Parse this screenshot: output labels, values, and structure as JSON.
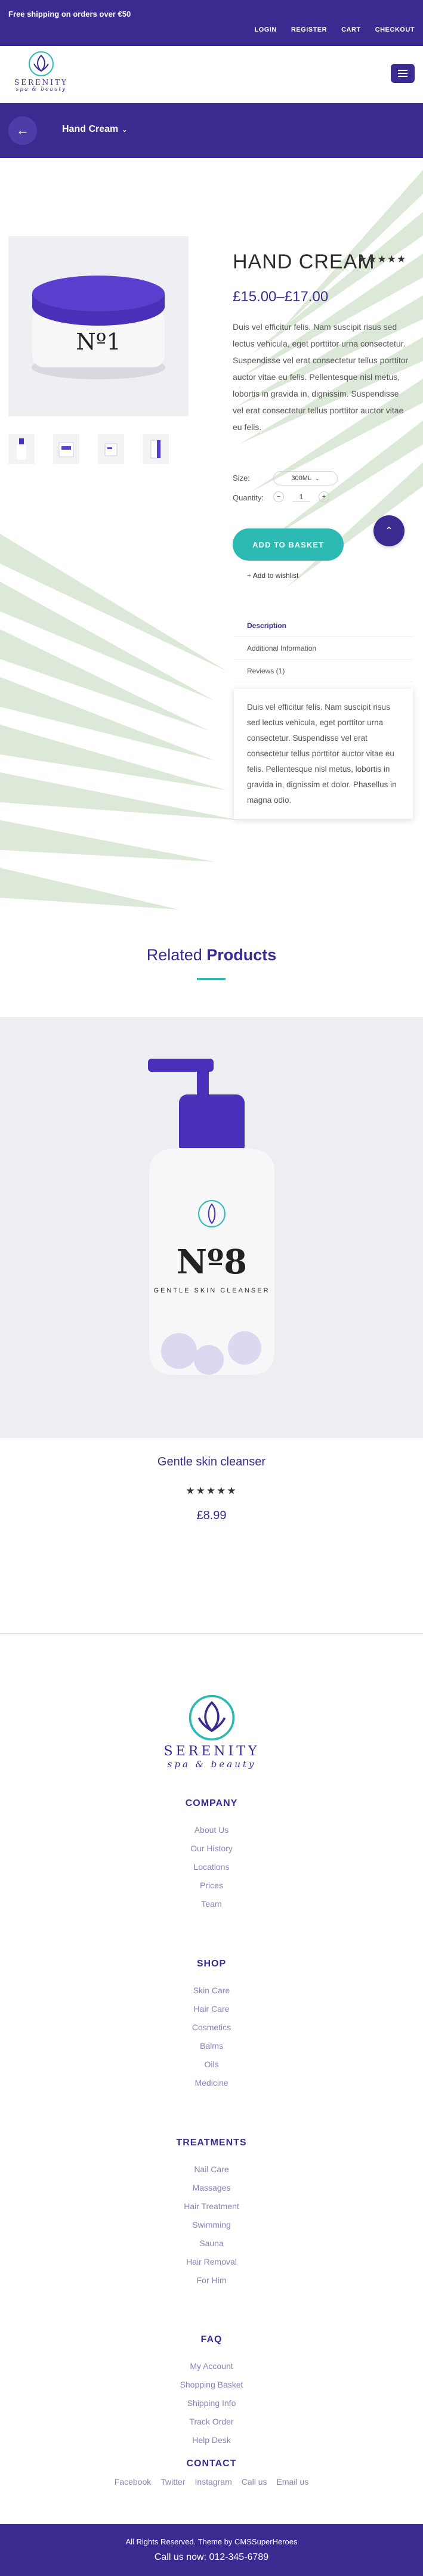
{
  "topbar": {
    "shipping": "Free shipping on orders over €50",
    "links": [
      "LOGIN",
      "REGISTER",
      "CART",
      "CHECKOUT"
    ]
  },
  "brand": {
    "name": "SERENITY",
    "tagline": "spa & beauty"
  },
  "category": {
    "title": "Hand Cream"
  },
  "product": {
    "title": "HAND CREAM",
    "rating": "★★★★★",
    "price": "£15.00–£17.00",
    "description": "Duis vel efficitur felis. Nam suscipit risus sed lectus vehicula, eget porttitor urna consectetur. Suspendisse vel erat consectetur tellus porttitor auctor vitae eu felis. Pellentesque nisl metus, lobortis in gravida in, dignissim. Suspendisse vel erat consectetur tellus porttitor auctor vitae eu felis.",
    "size_label": "Size:",
    "size_value": "300ML",
    "qty_label": "Quantity:",
    "qty_value": "1",
    "add_to_basket": "ADD TO BASKET",
    "wishlist": "Add to wishlist",
    "image_label": "Nº1"
  },
  "tabs": [
    "Description",
    "Additional Information",
    "Reviews (1)"
  ],
  "tab_panel": "Duis vel efficitur felis. Nam suscipit risus sed lectus vehicula, eget porttitor urna consectetur. Suspendisse vel erat consectetur tellus porttitor auctor vitae eu felis. Pellentesque nisl metus, lobortis in gravida in, dignissim et dolor. Phasellus in magna odio.",
  "related": {
    "title_light": "Related",
    "title_bold": "Products",
    "name": "Gentle skin cleanser",
    "rating": "★★★★★",
    "price": "£8.99",
    "image_label": "Nº8",
    "image_sub": "GENTLE SKIN CLEANSER"
  },
  "footer": {
    "columns": [
      {
        "title": "COMPANY",
        "links": [
          "About Us",
          "Our History",
          "Locations",
          "Prices",
          "Team"
        ]
      },
      {
        "title": "SHOP",
        "links": [
          "Skin Care",
          "Hair Care",
          "Cosmetics",
          "Balms",
          "Oils",
          "Medicine"
        ]
      },
      {
        "title": "TREATMENTS",
        "links": [
          "Nail Care",
          "Massages",
          "Hair Treatment",
          "Swimming",
          "Sauna",
          "Hair Removal",
          "For Him"
        ]
      },
      {
        "title": "FAQ",
        "links": [
          "My Account",
          "Shopping Basket",
          "Shipping Info",
          "Track Order",
          "Help Desk"
        ]
      },
      {
        "title": "CONTACT",
        "links": [
          "Facebook",
          "Twitter",
          "Instagram",
          "Call us",
          "Email us"
        ]
      }
    ],
    "rights": "All Rights Reserved. Theme by CMSSuperHeroes",
    "phone": "Call us now: 012-345-6789"
  },
  "colors": {
    "primary": "#3b2a8f",
    "accent": "#2bb9b2"
  },
  "icons": [
    "logo-lotus-icon",
    "menu-icon",
    "arrow-left-icon",
    "chevron-down-icon",
    "arrow-up-icon",
    "plus-icon",
    "minus-icon"
  ]
}
